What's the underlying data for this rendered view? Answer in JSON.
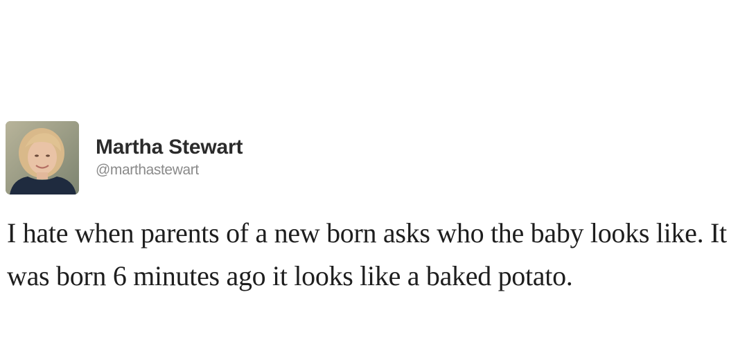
{
  "tweet": {
    "author": {
      "display_name": "Martha Stewart",
      "handle": "@marthastewart",
      "avatar_icon": "profile-photo"
    },
    "text": "I hate when parents of a new born asks who the baby looks like. It was born 6 minutes ago it looks like a baked potato."
  },
  "colors": {
    "background": "#ffffff",
    "name": "#2b2b2b",
    "handle": "#8a8a8a",
    "text": "#1e1e1e"
  }
}
